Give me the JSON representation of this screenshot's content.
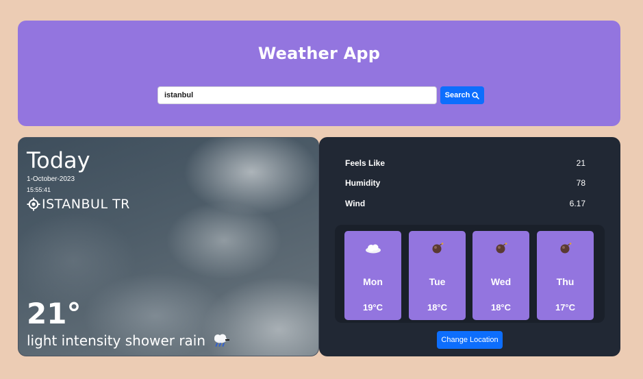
{
  "header": {
    "title": "Weather App",
    "search_value": "istanbul",
    "search_button_label": "Search"
  },
  "today": {
    "label": "Today",
    "date": "1-October-2023",
    "time": "15:55:41",
    "location": "ISTANBUL TR",
    "temperature": "21°",
    "condition": "light intensity shower rain"
  },
  "details": [
    {
      "label": "Feels Like",
      "value": "21"
    },
    {
      "label": "Humidity",
      "value": "78"
    },
    {
      "label": "Wind",
      "value": "6.17"
    }
  ],
  "forecast": [
    {
      "day": "Mon",
      "temp": "19°C",
      "icon": "cloud-icon"
    },
    {
      "day": "Tue",
      "temp": "18°C",
      "icon": "bomb-icon"
    },
    {
      "day": "Wed",
      "temp": "18°C",
      "icon": "bomb-icon"
    },
    {
      "day": "Thu",
      "temp": "17°C",
      "icon": "bomb-icon"
    }
  ],
  "change_location_label": "Change Location",
  "colors": {
    "page_bg": "#ecccb4",
    "accent_purple": "#9375df",
    "dark_card": "#212834",
    "button_blue": "#0d6efd"
  }
}
